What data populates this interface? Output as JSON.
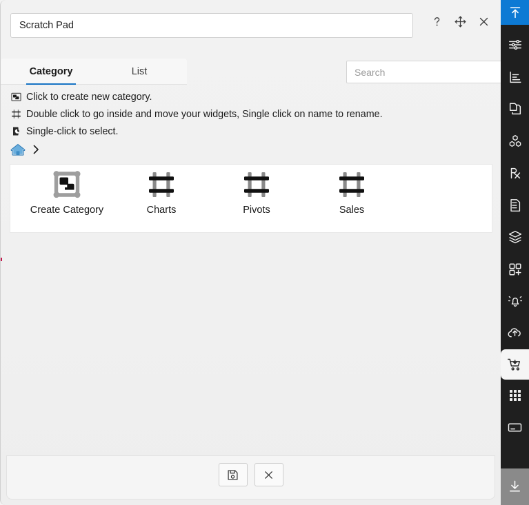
{
  "window": {
    "title_value": "Scratch Pad",
    "title_placeholder": "Name",
    "help_label": "?",
    "move_label": "Move",
    "close_label": "Close"
  },
  "tabs": [
    {
      "label": "Category",
      "active": true
    },
    {
      "label": "List",
      "active": false
    }
  ],
  "search": {
    "value": "",
    "placeholder": "Search"
  },
  "hints": [
    {
      "icon": "create-category-icon",
      "text": "Click to create new category."
    },
    {
      "icon": "frame-icon",
      "text": "Double click to go inside and move your widgets, Single click on name to rename."
    },
    {
      "icon": "cursor-click-icon",
      "text": "Single-click to select."
    }
  ],
  "breadcrumb": {
    "home_label": "Home",
    "separator": "›"
  },
  "tiles": [
    {
      "label": "Create Category",
      "icon": "create-category-tile-icon"
    },
    {
      "label": "Charts",
      "icon": "category-frame-icon"
    },
    {
      "label": "Pivots",
      "icon": "category-frame-icon"
    },
    {
      "label": "Sales",
      "icon": "category-frame-icon"
    }
  ],
  "footer": {
    "save_label": "Save",
    "cancel_label": "Close"
  },
  "sidebar": {
    "items": [
      {
        "name": "collapse-up-icon",
        "label": "Collapse",
        "state": "active-top"
      },
      {
        "name": "sliders-icon",
        "label": "Settings",
        "state": "normal"
      },
      {
        "name": "bar-chart-icon",
        "label": "Charts",
        "state": "normal"
      },
      {
        "name": "copy-documents-icon",
        "label": "Documents",
        "state": "normal"
      },
      {
        "name": "cubes-icon",
        "label": "Blocks",
        "state": "normal"
      },
      {
        "name": "rx-icon",
        "label": "Rx",
        "state": "normal"
      },
      {
        "name": "document-list-icon",
        "label": "Reports",
        "state": "normal"
      },
      {
        "name": "layers-icon",
        "label": "Layers",
        "state": "normal"
      },
      {
        "name": "add-grid-icon",
        "label": "Add Widget",
        "state": "normal"
      },
      {
        "name": "bell-alert-icon",
        "label": "Alerts",
        "state": "normal"
      },
      {
        "name": "cloud-upload-icon",
        "label": "Upload",
        "state": "normal"
      },
      {
        "name": "shopping-cart-icon",
        "label": "Scratch Pad",
        "state": "selected"
      },
      {
        "name": "grid-dots-icon",
        "label": "Apps",
        "state": "normal"
      },
      {
        "name": "window-icon",
        "label": "Window",
        "state": "normal"
      },
      {
        "name": "download-icon",
        "label": "Download",
        "state": "bottom"
      }
    ]
  },
  "colors": {
    "accent_blue": "#1673c4",
    "sidebar_bg": "#1f1f1f",
    "sidebar_active": "#0d7ad4",
    "home_icon_blue": "#4a9fd8"
  }
}
